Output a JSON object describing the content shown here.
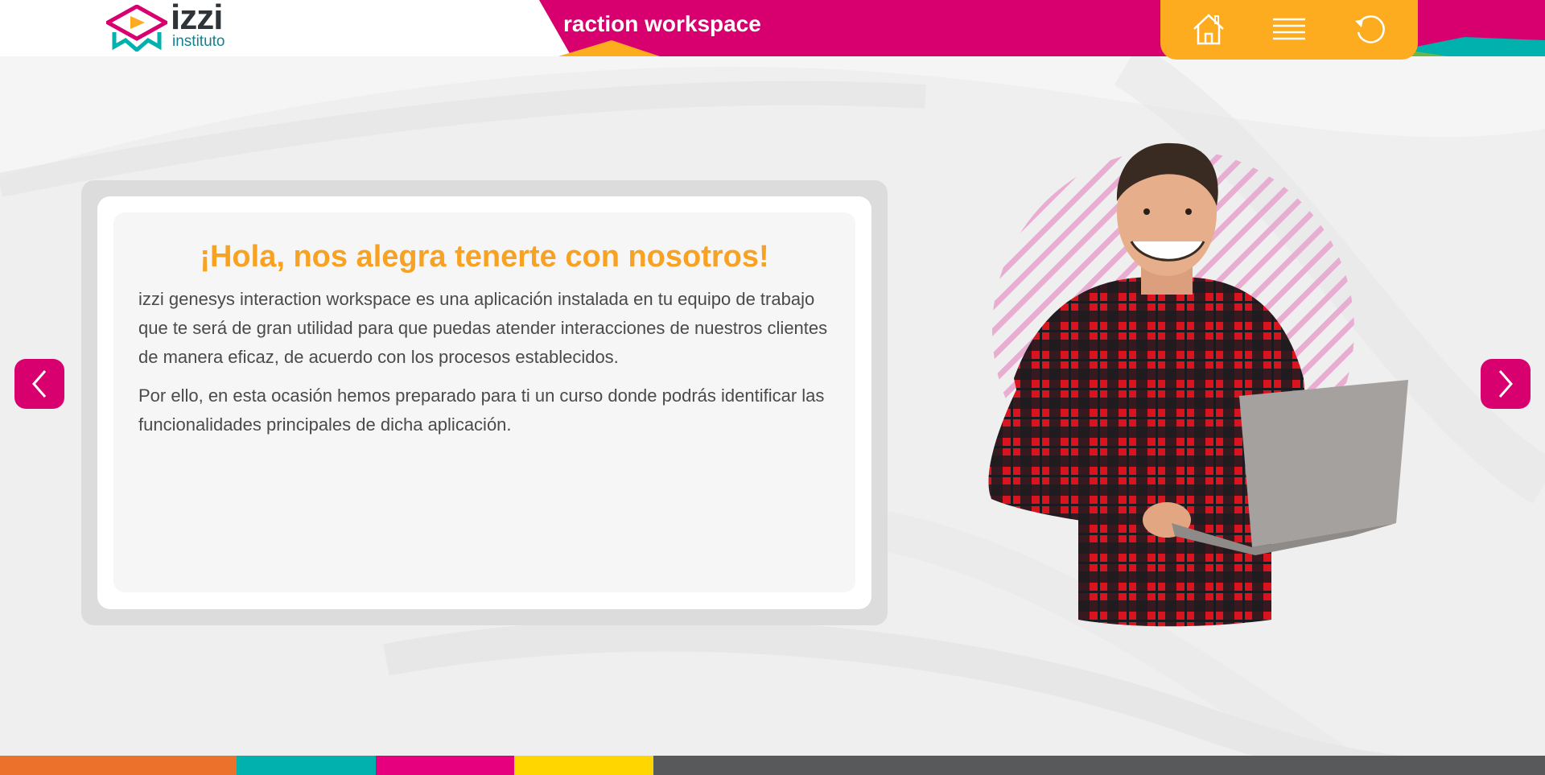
{
  "header": {
    "title": "raction workspace",
    "logo_word": "izzi",
    "logo_sub": "instituto"
  },
  "nav": {
    "home_icon": "home-icon",
    "menu_icon": "hamburger-menu-icon",
    "reload_icon": "reload-icon"
  },
  "card": {
    "heading": "¡Hola, nos alegra tenerte con nosotros!",
    "paragraph_1": "izzi genesys interaction workspace es una aplicación instalada en tu equipo de trabajo que te será de gran utilidad para que puedas atender interacciones de nuestros clientes de manera eficaz, de acuerdo con los procesos establecidos.",
    "paragraph_2": "Por ello, en esta ocasión hemos preparado para ti un curso donde podrás identificar las funcionalidades principales de dicha aplicación."
  },
  "arrows": {
    "prev_icon": "chevron-left-icon",
    "next_icon": "chevron-right-icon"
  },
  "colors": {
    "magenta": "#d8006f",
    "orange": "#fdab1f",
    "heading_orange": "#f7a222",
    "teal": "#00b1ae",
    "stripe_orange": "#ec722b",
    "stripe_yellow": "#ffd600",
    "stripe_gray": "#58595b"
  },
  "footer_stripes": [
    {
      "color": "#ec722b",
      "share": 0.153
    },
    {
      "color": "#00b1ae",
      "share": 0.09
    },
    {
      "color": "#e6007e",
      "share": 0.09
    },
    {
      "color": "#ffd600",
      "share": 0.09
    },
    {
      "color": "#58595b",
      "share": 0.577
    }
  ]
}
